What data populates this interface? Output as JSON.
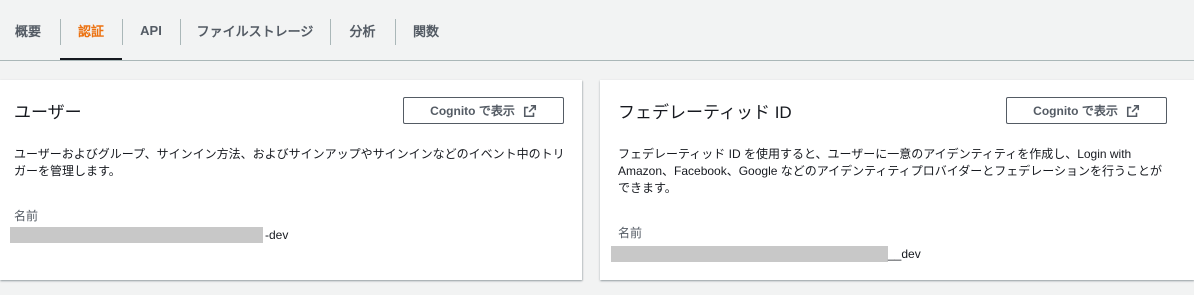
{
  "tabs": [
    {
      "label": "概要",
      "active": false
    },
    {
      "label": "認証",
      "active": true
    },
    {
      "label": "API",
      "active": false
    },
    {
      "label": "ファイルストレージ",
      "active": false
    },
    {
      "label": "分析",
      "active": false
    },
    {
      "label": "関数",
      "active": false
    }
  ],
  "colors": {
    "active_tab": "#ec7211",
    "background": "#f2f3f3",
    "redaction": "#c8c8c8"
  },
  "user_panel": {
    "title": "ユーザー",
    "button_label": "Cognito で表示",
    "button_icon": "external-link-icon",
    "description": "ユーザーおよびグループ、サインイン方法、およびサインアップやサインインなどのイベント中のトリガーを管理します。",
    "name_label": "名前",
    "name_suffix": "-dev"
  },
  "federated_panel": {
    "title": "フェデレーティッド ID",
    "button_label": "Cognito で表示",
    "button_icon": "external-link-icon",
    "description": "フェデレーティッド ID を使用すると、ユーザーに一意のアイデンティティを作成し、Login with Amazon、Facebook、Google などのアイデンティティプロバイダーとフェデレーションを行うことができます。",
    "name_label": "名前",
    "name_suffix": "__dev"
  }
}
